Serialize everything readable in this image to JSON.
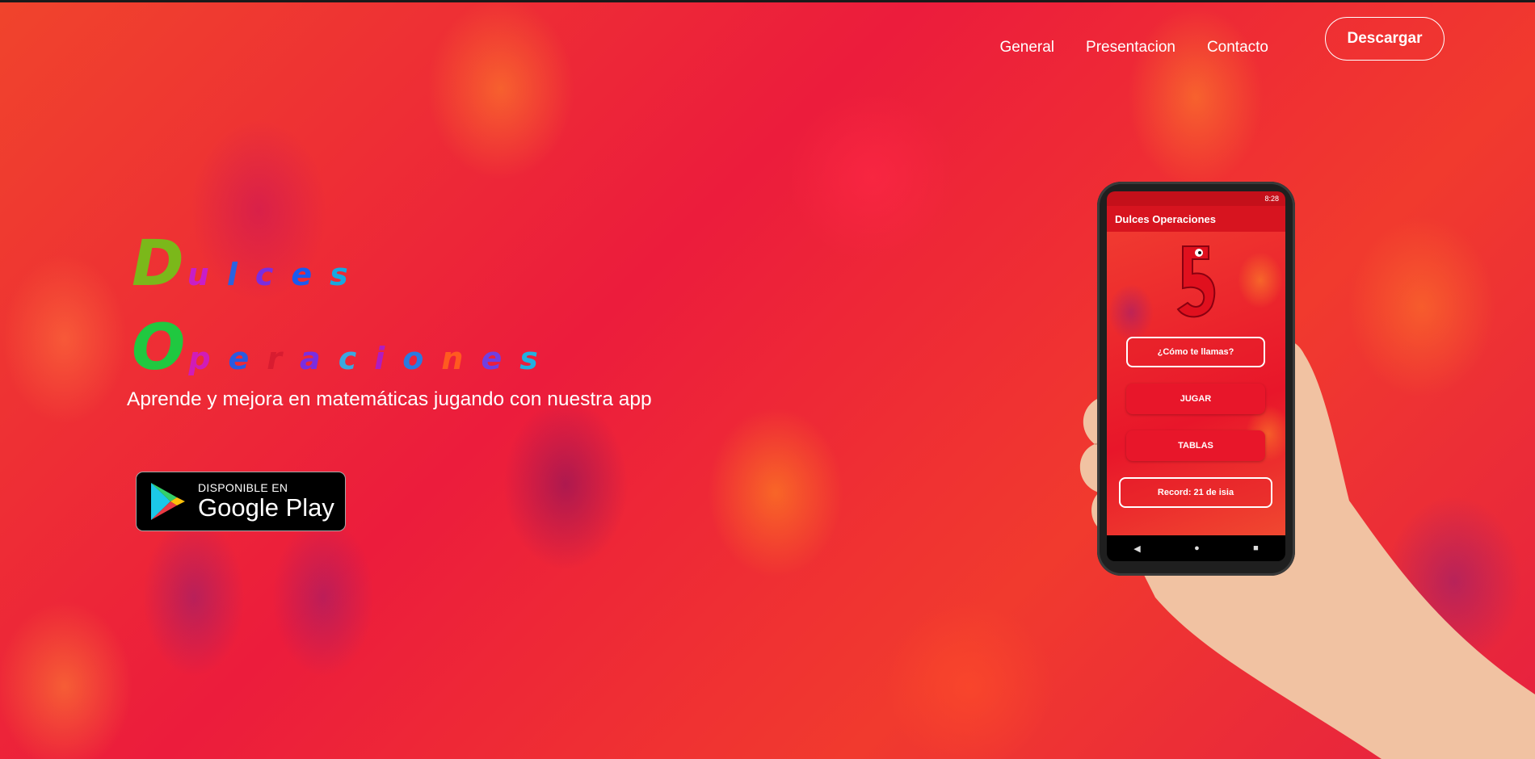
{
  "nav": {
    "links": [
      "General",
      "Presentacion",
      "Contacto"
    ],
    "download_label": "Descargar"
  },
  "hero": {
    "title_word1": "Dulces",
    "title_word2": "Operaciones",
    "subtitle": "Aprende y mejora en matemáticas jugando con nuestra app",
    "badge_small": "DISPONIBLE EN",
    "badge_big": "Google Play"
  },
  "phone": {
    "status_time": "8:28",
    "app_title": "Dulces Operaciones",
    "name_button": "¿Cómo te llamas?",
    "play_button": "JUGAR",
    "tables_button": "TABLAS",
    "record_label": "Record: 21 de isia"
  },
  "colors": {
    "background_accent": "#e8202e",
    "title_letters": [
      "#7bb81a",
      "#c81ec8",
      "#2a62e0",
      "#7a2ee0",
      "#1a5af0",
      "#18a8e0",
      "#20c840",
      "#d01cb8",
      "#2a5ae0",
      "#d81c30",
      "#7a2ee0",
      "#3aa8e0",
      "#b01cc0",
      "#2a7ae0",
      "#ff5a20",
      "#7040e0",
      "#20b0e0"
    ]
  },
  "icons": {
    "play": "google-play-icon",
    "hand": "hand-holding-phone",
    "mascot": "number-5-mascot-icon"
  }
}
